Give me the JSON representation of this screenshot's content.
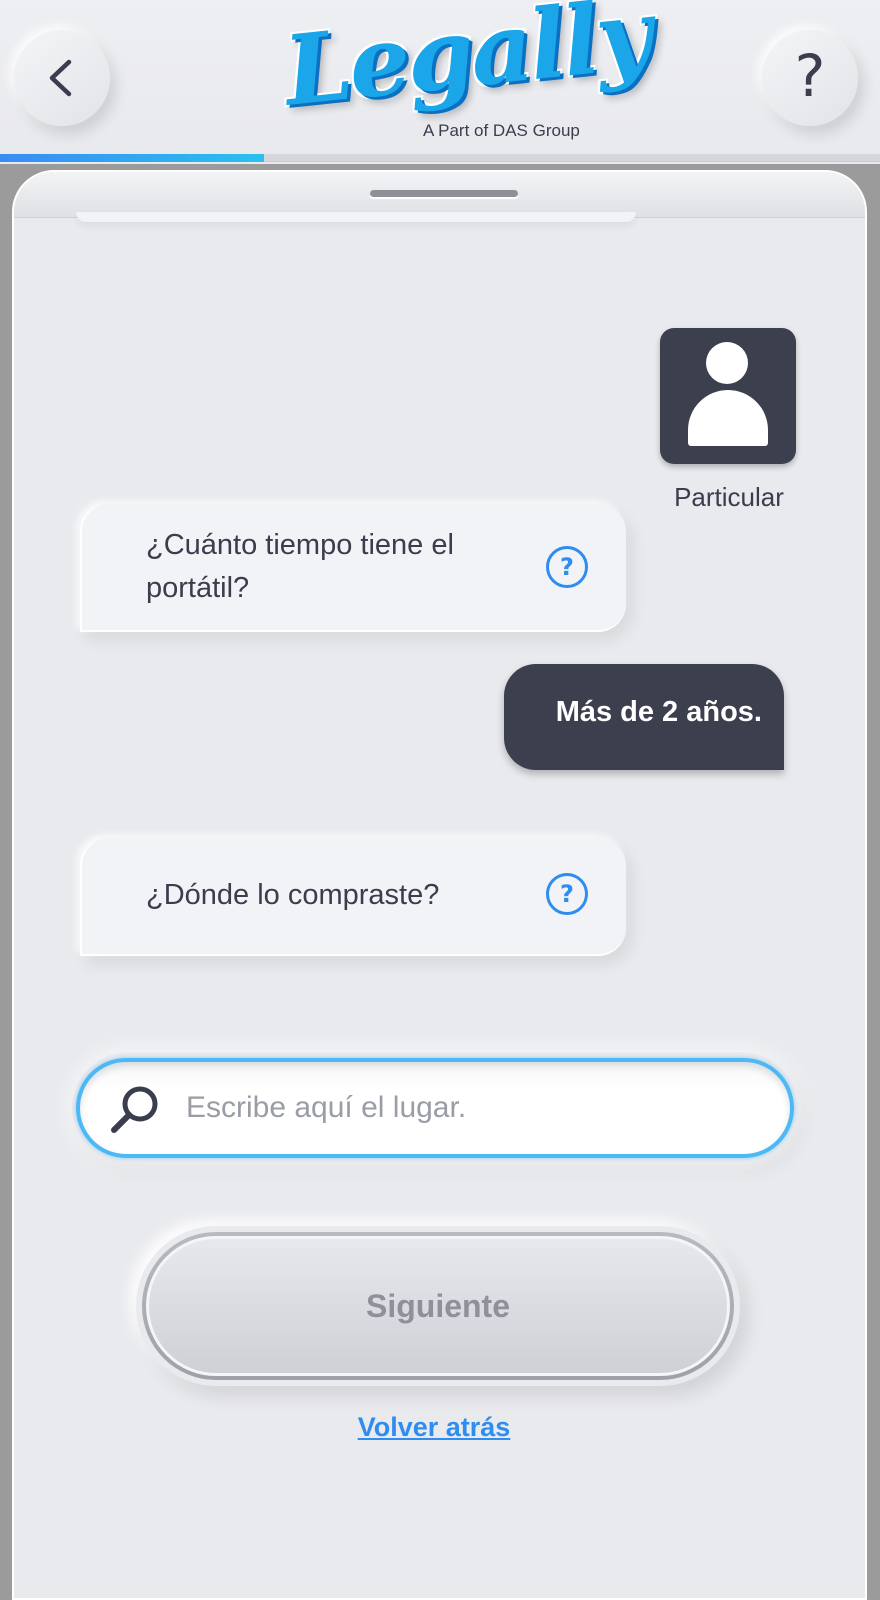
{
  "header": {
    "logo_text": "Legally",
    "logo_subtitle": "A Part of DAS Group",
    "back_icon": "chevron-left-icon",
    "help_label": "?",
    "progress": 0.3
  },
  "chat": {
    "user_type_label": "Particular",
    "messages": [
      {
        "from": "bot",
        "text": "¿Cuánto tiempo tiene el portátil?"
      },
      {
        "from": "user",
        "text": "Más de 2 años."
      },
      {
        "from": "bot",
        "text": "¿Dónde lo compraste?"
      }
    ],
    "help_icon": "question-circle-icon",
    "help_glyph": "?"
  },
  "search": {
    "placeholder": "Escribe aquí el lugar.",
    "value": "",
    "icon": "search-icon"
  },
  "actions": {
    "next_label": "Siguiente",
    "back_link_label": "Volver atrás"
  },
  "colors": {
    "accent": "#2f8df0",
    "field_border": "#4cb8f5",
    "user_bubble": "#3c3f4e",
    "background": "#e9eaee"
  }
}
